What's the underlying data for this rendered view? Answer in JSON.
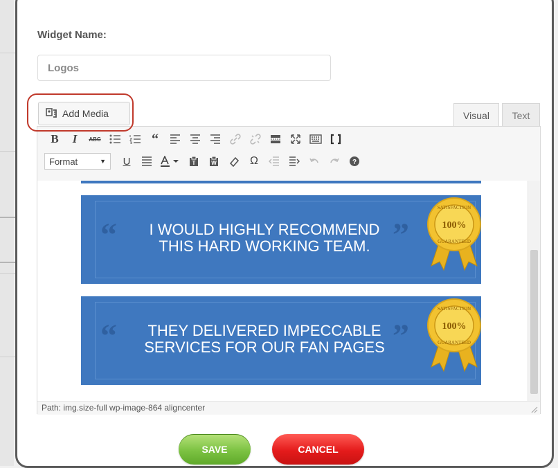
{
  "widget": {
    "name_label": "Widget Name:",
    "name_value": "Logos"
  },
  "media": {
    "add_media_label": "Add Media"
  },
  "tabs": [
    {
      "label": "Visual",
      "active": true
    },
    {
      "label": "Text",
      "active": false
    }
  ],
  "toolbar": {
    "format_label": "Format",
    "row1_icons": [
      "bold-icon",
      "italic-icon",
      "strikethrough-icon",
      "bullet-list-icon",
      "numbered-list-icon",
      "blockquote-icon",
      "align-left-icon",
      "align-center-icon",
      "align-right-icon",
      "link-icon",
      "unlink-icon",
      "read-more-icon",
      "fullscreen-icon",
      "toolbar-toggle-icon",
      "distraction-free-icon"
    ],
    "row2_icons": [
      "format-select",
      "underline-icon",
      "justify-icon",
      "text-color-icon",
      "paste-text-icon",
      "paste-word-icon",
      "clear-formatting-icon",
      "special-character-icon",
      "outdent-icon",
      "indent-icon",
      "undo-icon",
      "redo-icon",
      "help-icon"
    ]
  },
  "content": {
    "banners": [
      {
        "line1": "I WOULD HIGHLY RECOMMEND",
        "line2": "THIS HARD WORKING TEAM."
      },
      {
        "line1": "THEY DELIVERED IMPECCABLE",
        "line2": "SERVICES FOR OUR FAN PAGES"
      }
    ],
    "seal": {
      "top_text": "SATISFACTION",
      "value": "100%",
      "bottom_text": "GUARANTEED"
    },
    "banner_color": "#3f78bf",
    "seal_color": "#f2c230"
  },
  "statusbar": {
    "path": "Path: img.size-full wp-image-864 aligncenter"
  },
  "actions": {
    "save_label": "SAVE",
    "cancel_label": "CANCEL",
    "save_color": "#7cc242",
    "cancel_color": "#e41b1b"
  }
}
